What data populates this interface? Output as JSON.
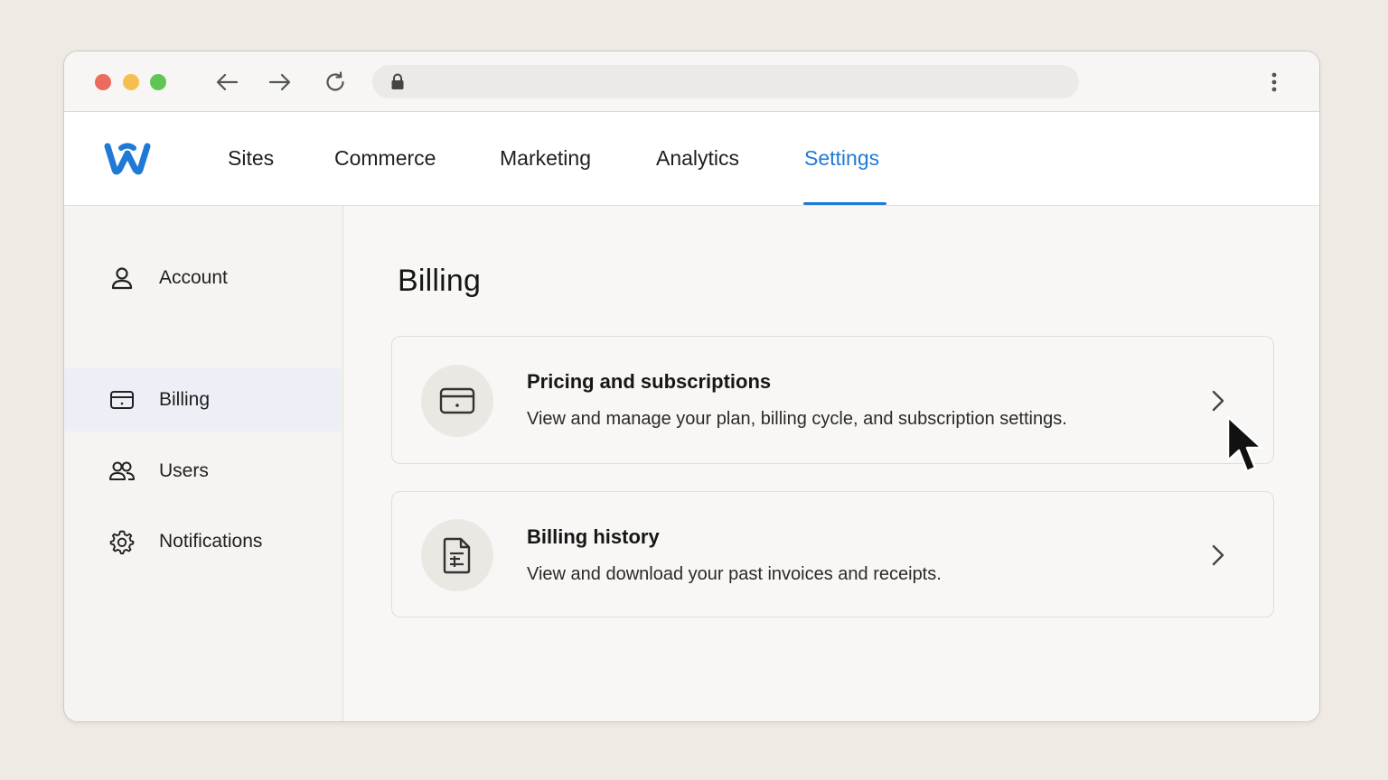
{
  "browser": {
    "url": ""
  },
  "topnav": {
    "items": [
      {
        "label": "Sites",
        "active": false
      },
      {
        "label": "Commerce",
        "active": false
      },
      {
        "label": "Marketing",
        "active": false
      },
      {
        "label": "Analytics",
        "active": false
      },
      {
        "label": "Settings",
        "active": true
      }
    ]
  },
  "sidebar": {
    "items": [
      {
        "label": "Account",
        "icon": "user-icon",
        "active": false
      },
      {
        "label": "Billing",
        "icon": "credit-card-icon",
        "active": true
      },
      {
        "label": "Users",
        "icon": "users-icon",
        "active": false
      },
      {
        "label": "Notifications",
        "icon": "gear-icon",
        "active": false
      }
    ]
  },
  "main": {
    "title": "Billing",
    "cards": [
      {
        "title": "Pricing and subscriptions",
        "description": "View and manage your plan, billing cycle, and subscription settings.",
        "icon": "credit-card-icon"
      },
      {
        "title": "Billing history",
        "description": "View and download your past invoices and receipts.",
        "icon": "document-icon"
      }
    ]
  },
  "colors": {
    "accent": "#1f7ad6",
    "background": "#efebe4",
    "sidebar_active": "#ecf0f6"
  }
}
